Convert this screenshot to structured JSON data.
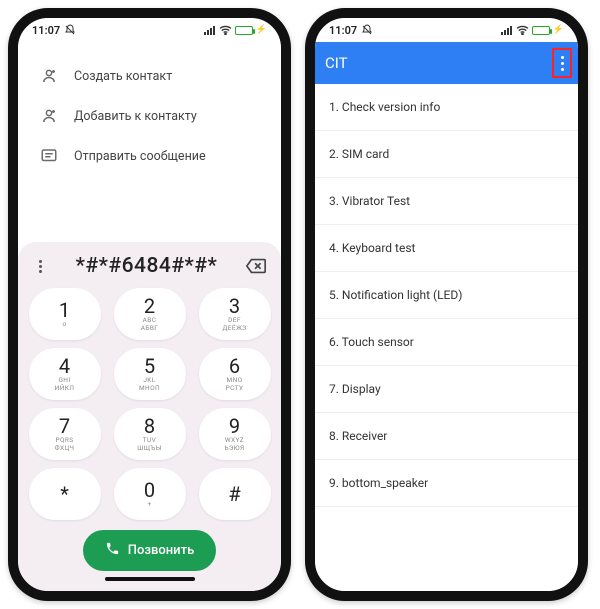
{
  "statusbar": {
    "time": "11:07"
  },
  "dialer": {
    "options": {
      "create": "Создать контакт",
      "add": "Добавить к контакту",
      "message": "Отправить сообщение"
    },
    "number": "*#*#6484#*#*",
    "keys": [
      {
        "d": "1",
        "s": "ᴏ"
      },
      {
        "d": "2",
        "s": "ABC\nАБВГ"
      },
      {
        "d": "3",
        "s": "DEF\nДЕЁЖЗ"
      },
      {
        "d": "4",
        "s": "GHI\nИЙКЛ"
      },
      {
        "d": "5",
        "s": "JKL\nМНОП"
      },
      {
        "d": "6",
        "s": "MNO\nРСТУ"
      },
      {
        "d": "7",
        "s": "PQRS\nФХЦЧ"
      },
      {
        "d": "8",
        "s": "TUV\nШЩЪЫ"
      },
      {
        "d": "9",
        "s": "WXYZ\nЬЭЮЯ"
      },
      {
        "d": "*",
        "s": ""
      },
      {
        "d": "0",
        "s": "+"
      },
      {
        "d": "#",
        "s": ""
      }
    ],
    "call_label": "Позвонить"
  },
  "cit": {
    "title": "CIT",
    "items": [
      "1. Check version info",
      "2. SIM card",
      "3. Vibrator Test",
      "4. Keyboard test",
      "5. Notification light (LED)",
      "6. Touch sensor",
      "7. Display",
      "8. Receiver",
      "9. bottom_speaker"
    ]
  }
}
